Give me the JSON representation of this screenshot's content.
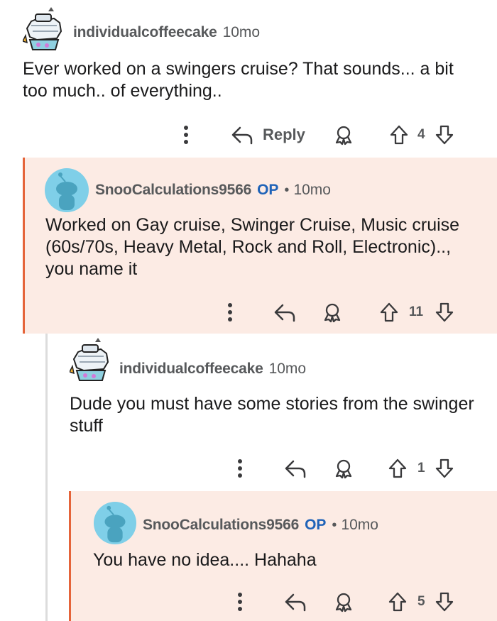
{
  "comments": [
    {
      "username": "individualcoffeecake",
      "op": "",
      "time": "10mo",
      "body": "Ever worked on a swingers cruise? That sounds... a bit too much.. of everything..",
      "reply_label": "Reply",
      "votes": "4"
    },
    {
      "username": "SnooCalculations9566",
      "op": "OP",
      "separator": "•",
      "time": "10mo",
      "body": "Worked on Gay cruise, Swinger Cruise, Music cruise (60s/70s, Heavy Metal, Rock and Roll, Electronic).., you name it",
      "votes": "11"
    },
    {
      "username": "individualcoffeecake",
      "op": "",
      "time": "10mo",
      "body": "Dude you must have some stories from the swinger stuff",
      "votes": "1"
    },
    {
      "username": "SnooCalculations9566",
      "op": "OP",
      "separator": "•",
      "time": "10mo",
      "body": "You have no idea.... Hahaha",
      "votes": "5"
    }
  ],
  "icons": {
    "more": "more-vertical-icon",
    "reply": "reply-arrow-icon",
    "award": "award-icon",
    "upvote": "upvote-arrow-icon",
    "downvote": "downvote-arrow-icon"
  },
  "colors": {
    "highlight_bg": "#fcebe4",
    "op_thread_line": "#e5643a",
    "thread_line": "#dcdcdc",
    "op_badge": "#1f63b8",
    "meta_text": "#57595b",
    "snoo_avatar_bg": "#7fcfe8"
  }
}
